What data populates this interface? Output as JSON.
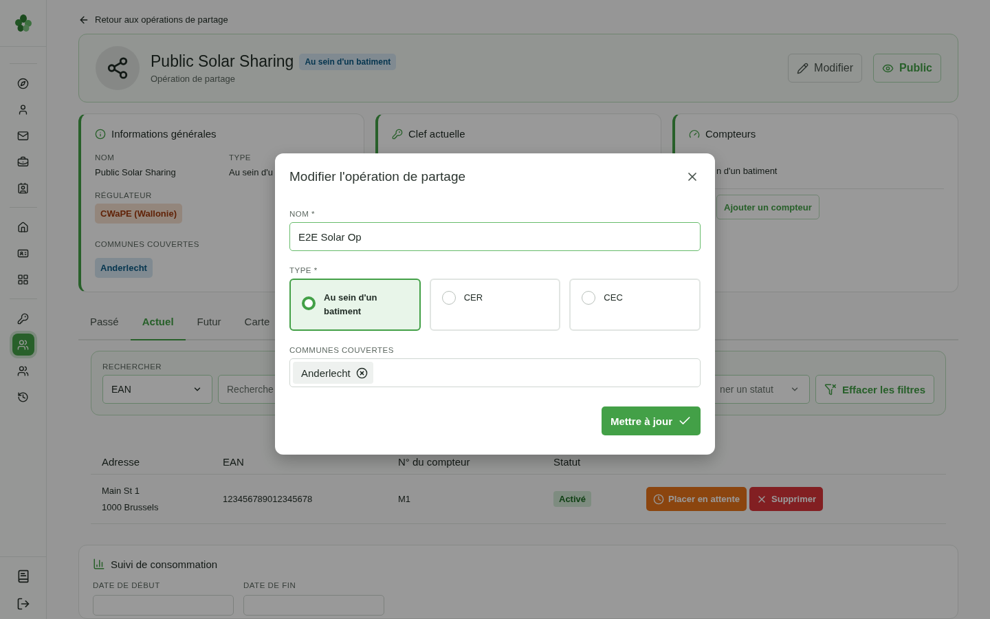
{
  "sidebar": {
    "groups": [
      [
        {
          "selected": false
        },
        {
          "selected": false
        },
        {
          "selected": false
        },
        {
          "selected": false
        },
        {
          "selected": false
        }
      ],
      [
        {
          "selected": false
        },
        {
          "selected": false
        },
        {
          "selected": false
        }
      ],
      [
        {
          "selected": false
        },
        {
          "selected": true
        },
        {
          "selected": false
        },
        {
          "selected": false
        }
      ]
    ],
    "footer": [
      {
        "selected": false
      },
      {
        "selected": false
      }
    ]
  },
  "back_link": "Retour aux opérations de partage",
  "header": {
    "title": "Public Solar Sharing",
    "badge": "Au sein d'un batiment",
    "subtitle": "Opération de partage",
    "buttons": [
      {
        "label": "Modifier",
        "kind": "edit"
      },
      {
        "label": "Public",
        "kind": "public"
      }
    ]
  },
  "info_card": {
    "title": "Informations générales",
    "fields": [
      {
        "label": "NOM",
        "value": "Public Solar Sharing"
      },
      {
        "label": "TYPE",
        "value": "Au sein d'u"
      }
    ],
    "regulator": {
      "label": "RÉGULATEUR",
      "value": "CWaPE (Wallonie)"
    },
    "communes": {
      "label": "COMMUNES COUVERTES",
      "tags": [
        "Anderlecht"
      ]
    }
  },
  "key_card": {
    "title": "Clef actuelle"
  },
  "meters_card": {
    "title": "Compteurs",
    "text": "n d'un batiment",
    "button": "Ajouter un compteur"
  },
  "tabs": [
    {
      "label": "Passé",
      "selected": false
    },
    {
      "label": "Actuel",
      "selected": true
    },
    {
      "label": "Futur",
      "selected": false
    },
    {
      "label": "Carte",
      "selected": false
    }
  ],
  "filters": {
    "label": "RECHERCHER",
    "field_select": "EAN",
    "search_placeholder": "Recherche",
    "status_placeholder": "ner un statut",
    "clear_button": "Effacer les filtres"
  },
  "table": {
    "columns": [
      "Adresse",
      "EAN",
      "N° du compteur",
      "Statut"
    ],
    "rows": [
      {
        "address": [
          "Main St 1",
          "1000 Brussels"
        ],
        "ean": "123456789012345678",
        "meter": "M1",
        "status": "Activé",
        "actions": [
          {
            "label": "Placer en attente",
            "kind": "hold"
          },
          {
            "label": "Supprimer",
            "kind": "delete"
          }
        ]
      }
    ]
  },
  "consumption": {
    "title": "Suivi de consommation",
    "fields": [
      "DATE DE DÉBUT",
      "DATE DE FIN"
    ]
  },
  "modal": {
    "title": "Modifier l'opération de partage",
    "name_label": "NOM *",
    "name_value": "E2E Solar Op",
    "type_label": "TYPE *",
    "types": [
      {
        "label": "Au sein d'un batiment",
        "selected": true
      },
      {
        "label": "CER",
        "selected": false
      },
      {
        "label": "CEC",
        "selected": false
      }
    ],
    "communes_label": "COMMUNES COUVERTES",
    "communes": [
      "Anderlecht"
    ],
    "submit": "Mettre à jour"
  }
}
